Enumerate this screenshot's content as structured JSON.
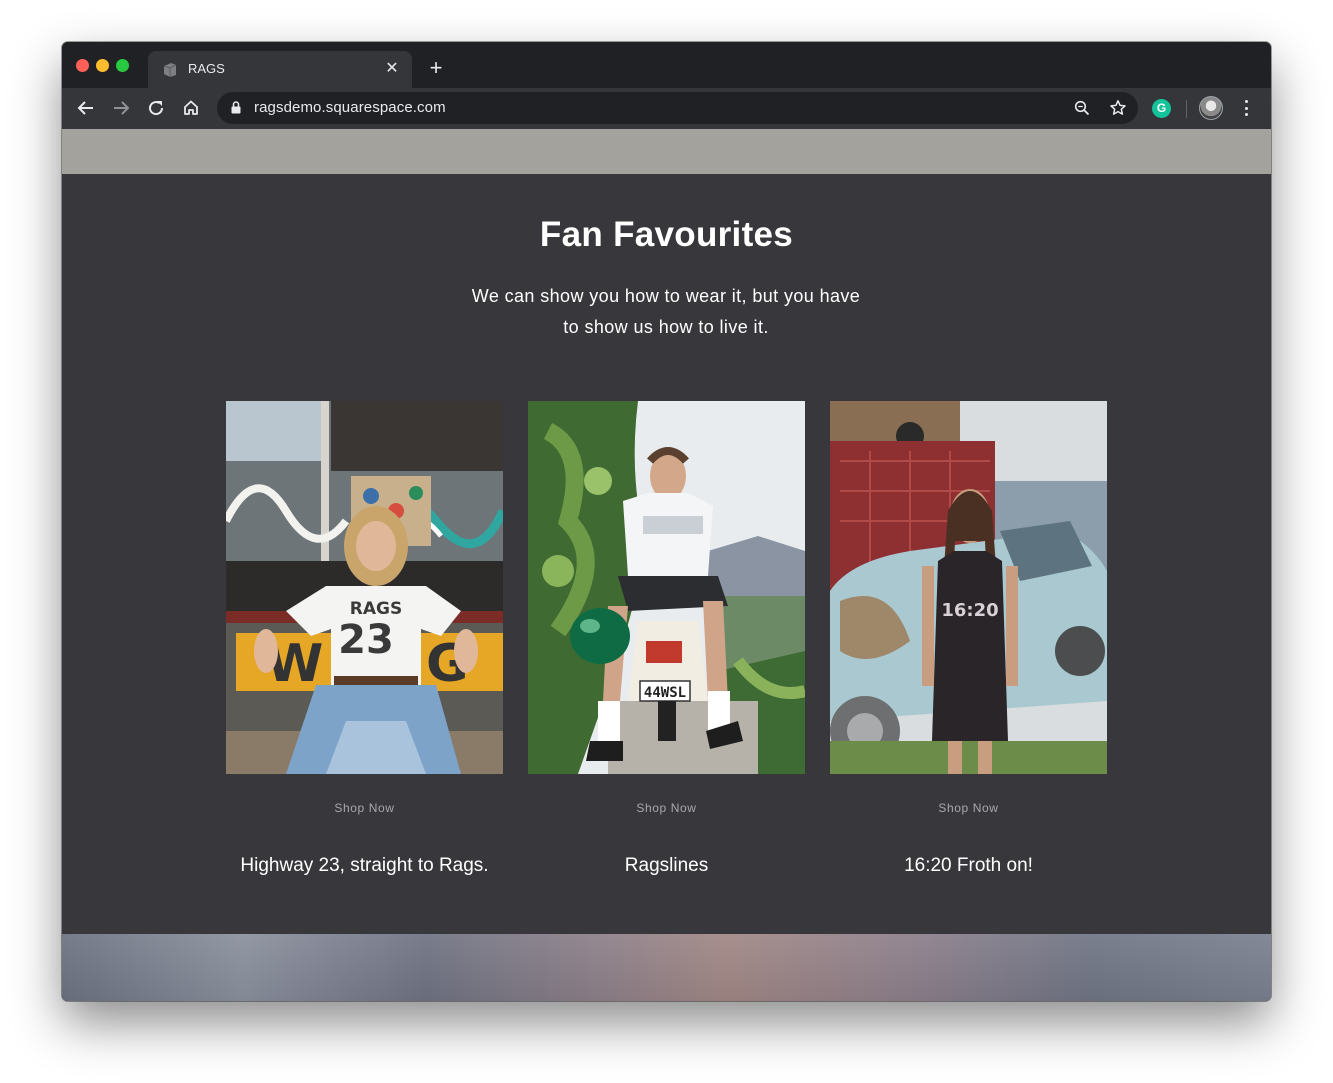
{
  "browser": {
    "tab_title": "RAGS",
    "url": "ragsdemo.squarespace.com"
  },
  "section": {
    "title": "Fan Favourites",
    "subtitle_line1": "We can show you how to wear it, but you have",
    "subtitle_line2": "to show us how to live it."
  },
  "cards": [
    {
      "shop_label": "Shop Now",
      "caption": "Highway 23, straight to Rags.",
      "shirt_text_top": "RAGS",
      "shirt_text_bottom": "23"
    },
    {
      "shop_label": "Shop Now",
      "caption": "Ragslines",
      "plate_text": "44WSL"
    },
    {
      "shop_label": "Shop Now",
      "caption": "16:20 Froth on!",
      "shirt_text": "16:20"
    }
  ],
  "colors": {
    "page_bg": "#38383c",
    "top_band": "#a4a29d",
    "browser_frame": "#202124",
    "toolbar": "#35363a"
  }
}
